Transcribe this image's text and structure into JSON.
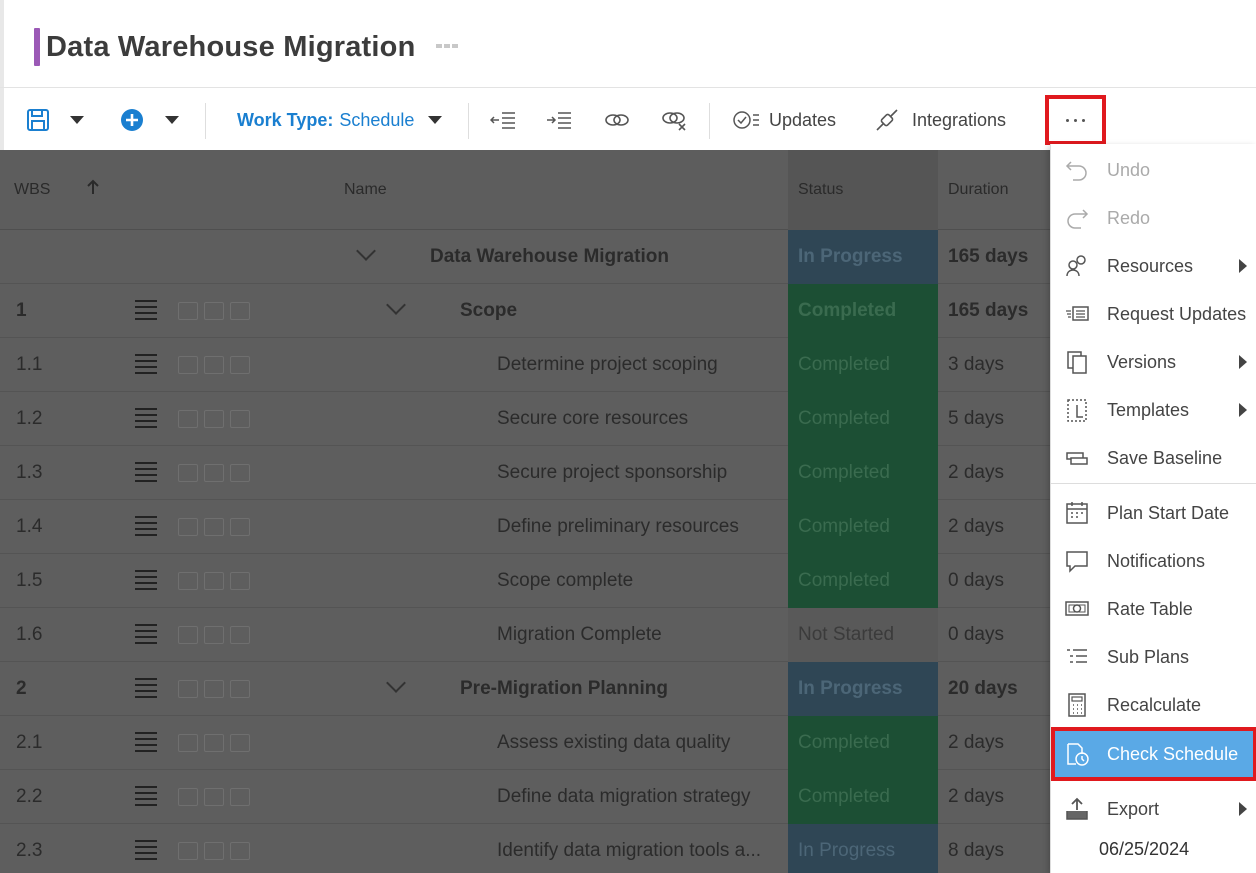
{
  "title": "Data Warehouse Migration",
  "toolbar": {
    "worktype_label": "Work Type:",
    "worktype_value": "Schedule",
    "updates_label": "Updates",
    "integrations_label": "Integrations"
  },
  "grid": {
    "headers": {
      "wbs": "WBS",
      "name": "Name",
      "status": "Status",
      "duration": "Duration"
    },
    "rows": [
      {
        "wbs": "",
        "name": "Data Warehouse Migration",
        "status": "In Progress",
        "duration": "165 days"
      },
      {
        "wbs": "1",
        "name": "Scope",
        "status": "Completed",
        "duration": "165 days"
      },
      {
        "wbs": "1.1",
        "name": "Determine project scoping",
        "status": "Completed",
        "duration": "3 days"
      },
      {
        "wbs": "1.2",
        "name": "Secure core resources",
        "status": "Completed",
        "duration": "5 days"
      },
      {
        "wbs": "1.3",
        "name": "Secure project sponsorship",
        "status": "Completed",
        "duration": "2 days"
      },
      {
        "wbs": "1.4",
        "name": "Define preliminary resources",
        "status": "Completed",
        "duration": "2 days"
      },
      {
        "wbs": "1.5",
        "name": "Scope complete",
        "status": "Completed",
        "duration": "0 days"
      },
      {
        "wbs": "1.6",
        "name": "Migration Complete",
        "status": "Not Started",
        "duration": "0 days"
      },
      {
        "wbs": "2",
        "name": "Pre-Migration Planning",
        "status": "In Progress",
        "duration": "20 days"
      },
      {
        "wbs": "2.1",
        "name": "Assess existing data quality",
        "status": "Completed",
        "duration": "2 days"
      },
      {
        "wbs": "2.2",
        "name": "Define data migration strategy",
        "status": "Completed",
        "duration": "2 days"
      },
      {
        "wbs": "2.3",
        "name": "Identify data migration tools a...",
        "status": "In Progress",
        "duration": "8 days"
      }
    ]
  },
  "menu": {
    "items": [
      {
        "label": "Undo",
        "icon": "undo-icon"
      },
      {
        "label": "Redo",
        "icon": "redo-icon"
      },
      {
        "label": "Resources",
        "icon": "resources-icon"
      },
      {
        "label": "Request Updates",
        "icon": "request-updates-icon"
      },
      {
        "label": "Versions",
        "icon": "versions-icon"
      },
      {
        "label": "Templates",
        "icon": "templates-icon"
      },
      {
        "label": "Save Baseline",
        "icon": "save-baseline-icon"
      },
      {
        "label": "Plan Start Date",
        "icon": "calendar-icon"
      },
      {
        "label": "Notifications",
        "icon": "notification-icon"
      },
      {
        "label": "Rate Table",
        "icon": "rate-table-icon"
      },
      {
        "label": "Sub Plans",
        "icon": "sub-plans-icon"
      },
      {
        "label": "Recalculate",
        "icon": "calculator-icon"
      },
      {
        "label": "Check Schedule",
        "icon": "check-schedule-icon"
      },
      {
        "label": "Export",
        "icon": "export-icon"
      }
    ],
    "date": "06/25/2024"
  },
  "colors": {
    "accent": "#9b59b6",
    "link": "#1a7fd0",
    "highlight": "#5aa9e6",
    "annotation_red": "#e0191e"
  }
}
